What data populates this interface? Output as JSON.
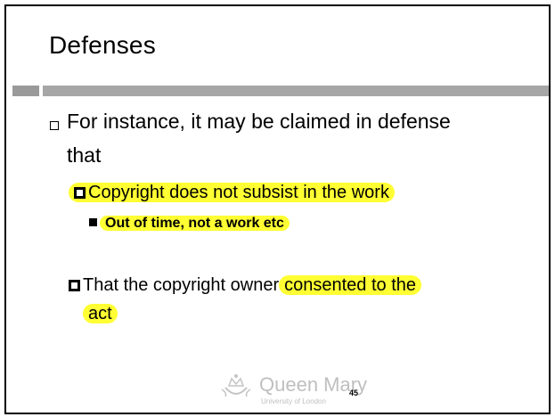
{
  "slide": {
    "title": "Defenses",
    "intro_line1": "For instance, it may be claimed in defense",
    "intro_line2": "that",
    "point1": "Copyright does not subsist in the work",
    "subpoint1": "Out of time, not a work etc",
    "point2_plain": "That the copyright owner",
    "point2_highlight_part1": "consented to the",
    "point2_highlight_part2": "act",
    "logo_name": "Queen Mary",
    "logo_subtitle": "University of London",
    "page_number": "45",
    "highlight_color": "#ffff33"
  }
}
